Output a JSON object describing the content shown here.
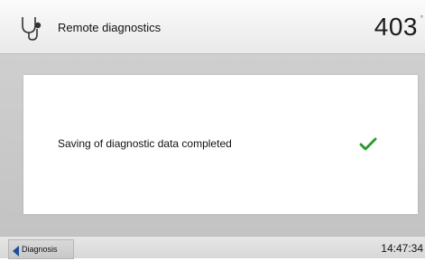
{
  "header": {
    "icon": "stethoscope-icon",
    "title": "Remote diagnostics",
    "temperature": "403",
    "temperature_unit": "°"
  },
  "message": {
    "text": "Saving of diagnostic data completed",
    "status_icon": "checkmark-icon",
    "status_color": "#2e9a2e"
  },
  "footer": {
    "back_label": "Diagnosis",
    "back_icon": "back-arrow-icon",
    "time": "14:47:34",
    "accent_color": "#1a4f9c"
  }
}
